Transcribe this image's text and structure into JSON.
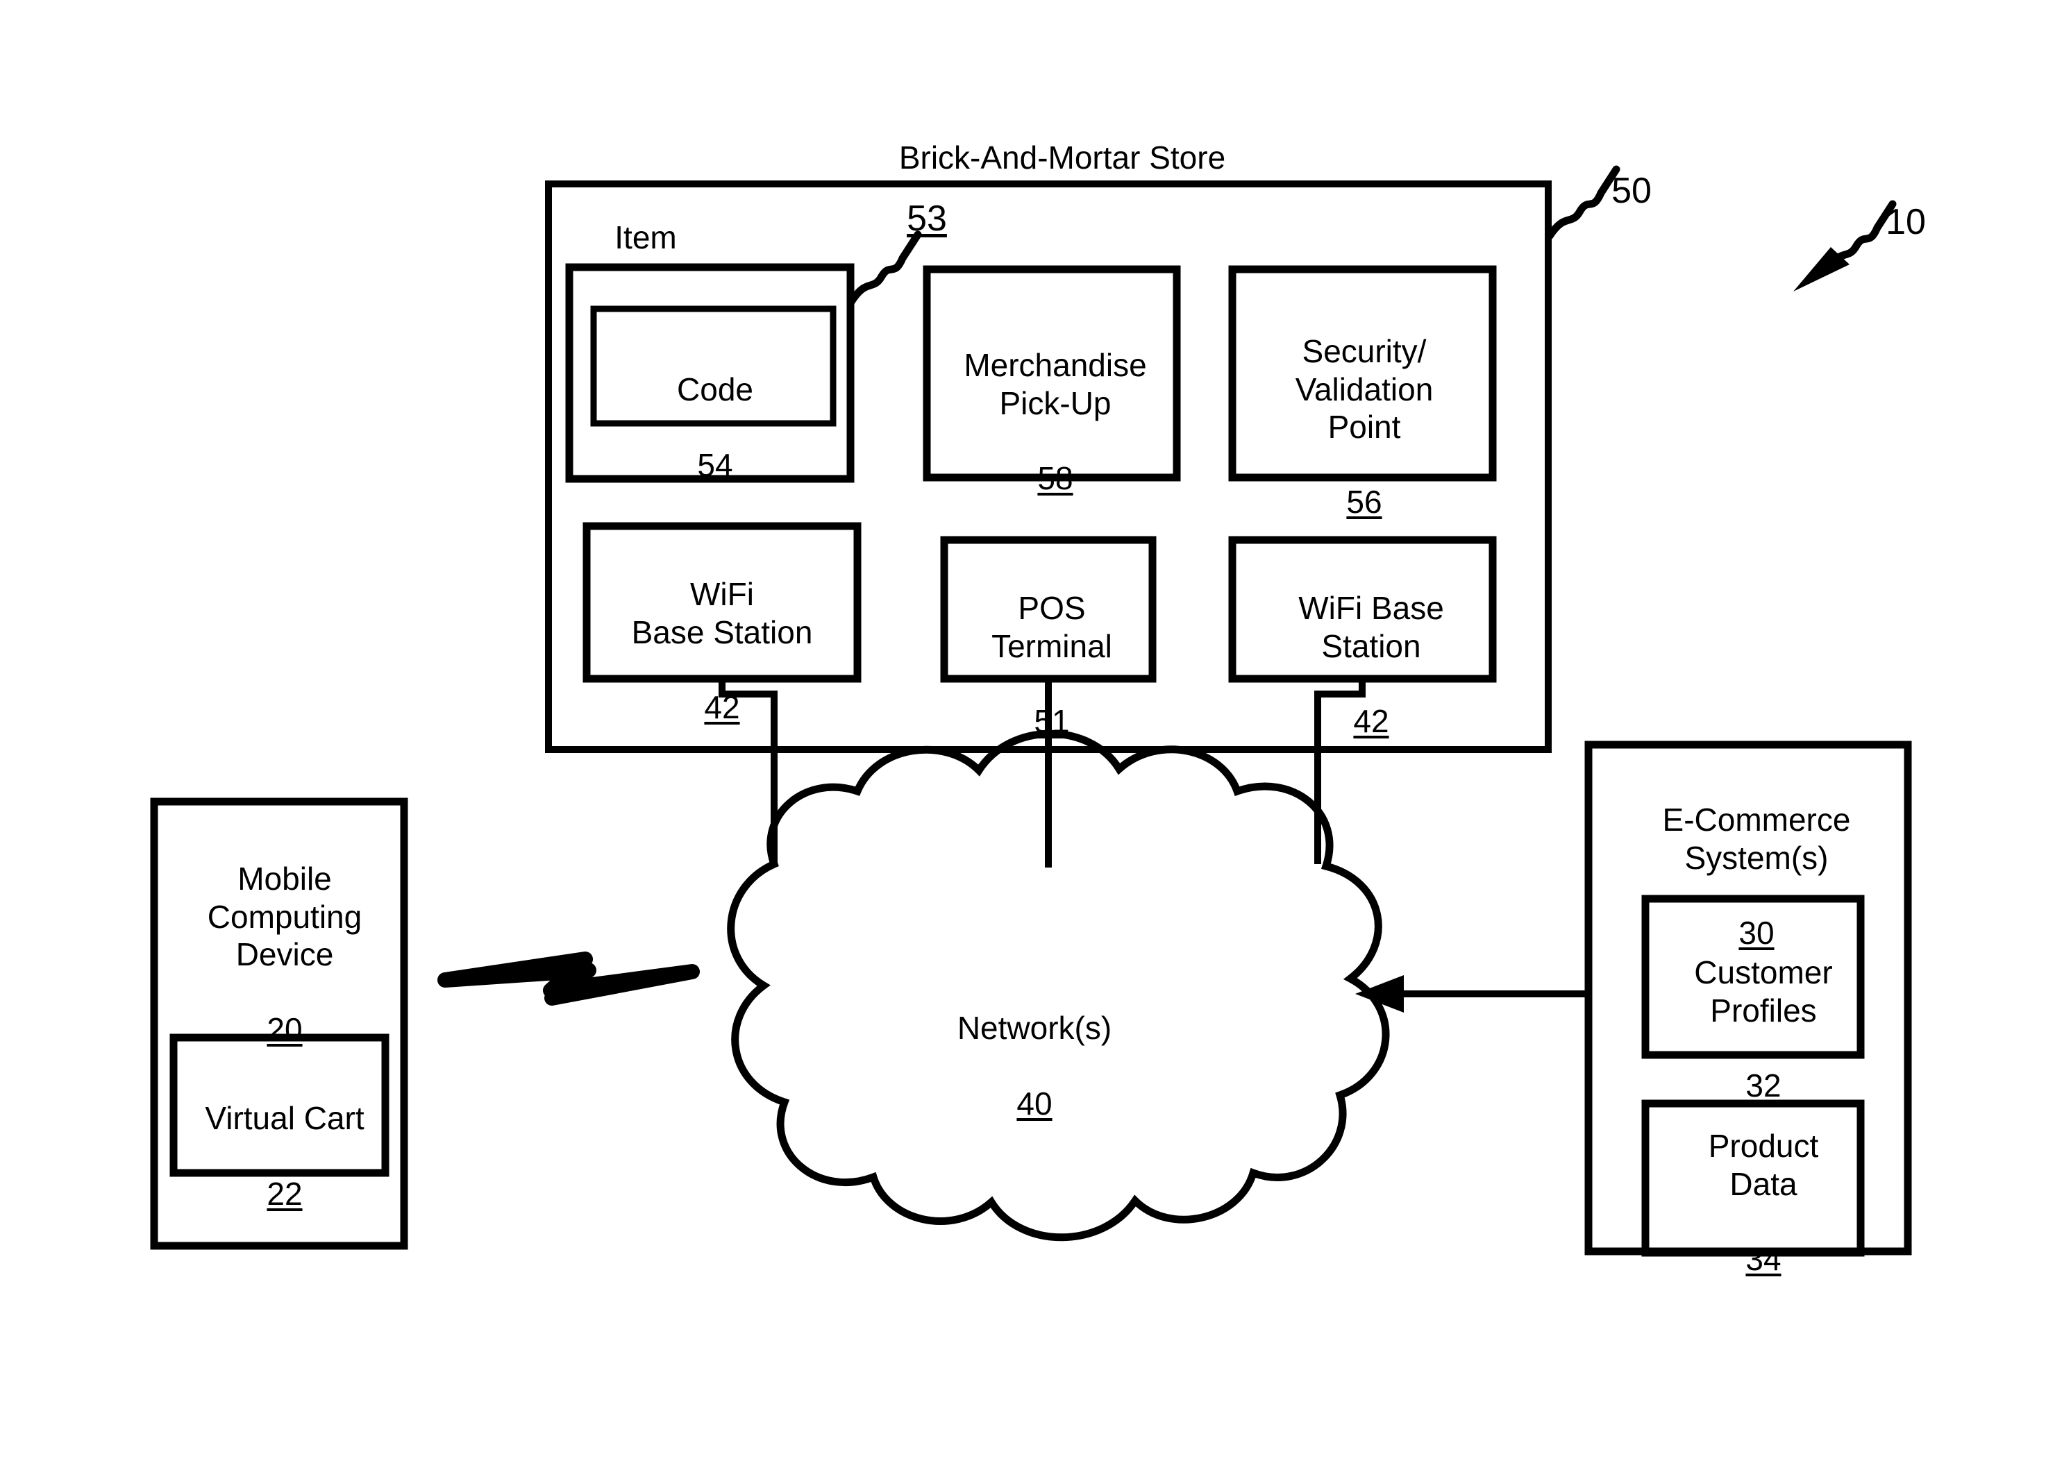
{
  "figure": {
    "system_ref": "10",
    "store_title": "Brick-And-Mortar Store",
    "store_ref": "50",
    "item_label": "Item",
    "item_ref": "53"
  },
  "store_boxes": [
    {
      "name": "item",
      "label": "Item",
      "ref": "53"
    },
    {
      "name": "code",
      "label": "Code",
      "ref": "54"
    },
    {
      "name": "merchandise-pickup",
      "label": "Merchandise\nPick-Up",
      "ref": "58"
    },
    {
      "name": "security-validation-point",
      "label": "Security/\nValidation\nPoint",
      "ref": "56"
    },
    {
      "name": "wifi-base-station-left",
      "label": "WiFi\nBase Station",
      "ref": "42"
    },
    {
      "name": "pos-terminal",
      "label": "POS\nTerminal",
      "ref": "51"
    },
    {
      "name": "wifi-base-station-right",
      "label": "WiFi Base\nStation",
      "ref": "42"
    }
  ],
  "network": {
    "label": "Network(s)",
    "ref": "40"
  },
  "mobile": {
    "label": "Mobile\nComputing\nDevice",
    "ref": "20",
    "cart_label": "Virtual Cart",
    "cart_ref": "22"
  },
  "ecommerce": {
    "label": "E-Commerce\nSystem(s)",
    "ref": "30",
    "customer_profiles_label": "Customer\nProfiles",
    "customer_profiles_ref": "32",
    "product_data_label": "Product\nData",
    "product_data_ref": "34"
  },
  "colors": {
    "ink": "#000000",
    "paper": "#ffffff"
  }
}
